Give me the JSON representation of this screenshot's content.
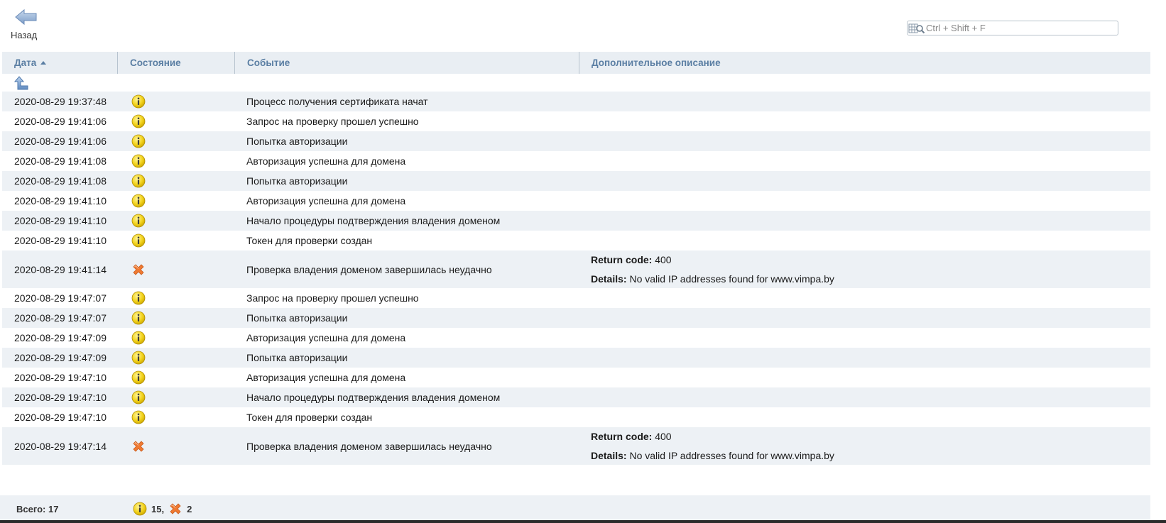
{
  "toolbar": {
    "back_label": "Назад",
    "back_icon": "arrow-left-icon",
    "search_placeholder": "Ctrl + Shift + F",
    "search_icon": "grid-search-icon"
  },
  "columns": [
    {
      "label": "Дата",
      "sorted": "asc"
    },
    {
      "label": "Состояние"
    },
    {
      "label": "Событие"
    },
    {
      "label": "Дополнительное описание"
    }
  ],
  "rows": [
    {
      "date": "2020-08-29 19:37:48",
      "status": "info",
      "event": "Процесс получения сертификата начат"
    },
    {
      "date": "2020-08-29 19:41:06",
      "status": "info",
      "event": "Запрос на проверку прошел успешно"
    },
    {
      "date": "2020-08-29 19:41:06",
      "status": "info",
      "event": "Попытка авторизации"
    },
    {
      "date": "2020-08-29 19:41:08",
      "status": "info",
      "event": "Авторизация успешна для домена"
    },
    {
      "date": "2020-08-29 19:41:08",
      "status": "info",
      "event": "Попытка авторизации"
    },
    {
      "date": "2020-08-29 19:41:10",
      "status": "info",
      "event": "Авторизация успешна для домена"
    },
    {
      "date": "2020-08-29 19:41:10",
      "status": "info",
      "event": "Начало процедуры подтверждения владения доменом"
    },
    {
      "date": "2020-08-29 19:41:10",
      "status": "info",
      "event": "Токен для проверки создан"
    },
    {
      "date": "2020-08-29 19:41:14",
      "status": "error",
      "event": "Проверка владения доменом завершилась неудачно",
      "details": [
        {
          "key": "Return code:",
          "value": "400"
        },
        {
          "key": "Details:",
          "value": "No valid IP addresses found for www.vimpa.by"
        }
      ]
    },
    {
      "date": "2020-08-29 19:47:07",
      "status": "info",
      "event": "Запрос на проверку прошел успешно"
    },
    {
      "date": "2020-08-29 19:47:07",
      "status": "info",
      "event": "Попытка авторизации"
    },
    {
      "date": "2020-08-29 19:47:09",
      "status": "info",
      "event": "Авторизация успешна для домена"
    },
    {
      "date": "2020-08-29 19:47:09",
      "status": "info",
      "event": "Попытка авторизации"
    },
    {
      "date": "2020-08-29 19:47:10",
      "status": "info",
      "event": "Авторизация успешна для домена"
    },
    {
      "date": "2020-08-29 19:47:10",
      "status": "info",
      "event": "Начало процедуры подтверждения владения доменом"
    },
    {
      "date": "2020-08-29 19:47:10",
      "status": "info",
      "event": "Токен для проверки создан"
    },
    {
      "date": "2020-08-29 19:47:14",
      "status": "error",
      "event": "Проверка владения доменом завершилась неудачно",
      "details": [
        {
          "key": "Return code:",
          "value": "400"
        },
        {
          "key": "Details:",
          "value": "No valid IP addresses found for www.vimpa.by"
        }
      ]
    }
  ],
  "footer": {
    "total_label": "Всего: 17",
    "info_count": "15,",
    "error_count": "2"
  },
  "icons": {
    "info": "info-icon",
    "error": "error-x-icon",
    "level_up": "level-up-icon"
  },
  "colors": {
    "header_text": "#5a7ea3",
    "row_alt": "#edf1f5",
    "info_yellow": "#f2d21b",
    "error_orange": "#f07a32"
  }
}
